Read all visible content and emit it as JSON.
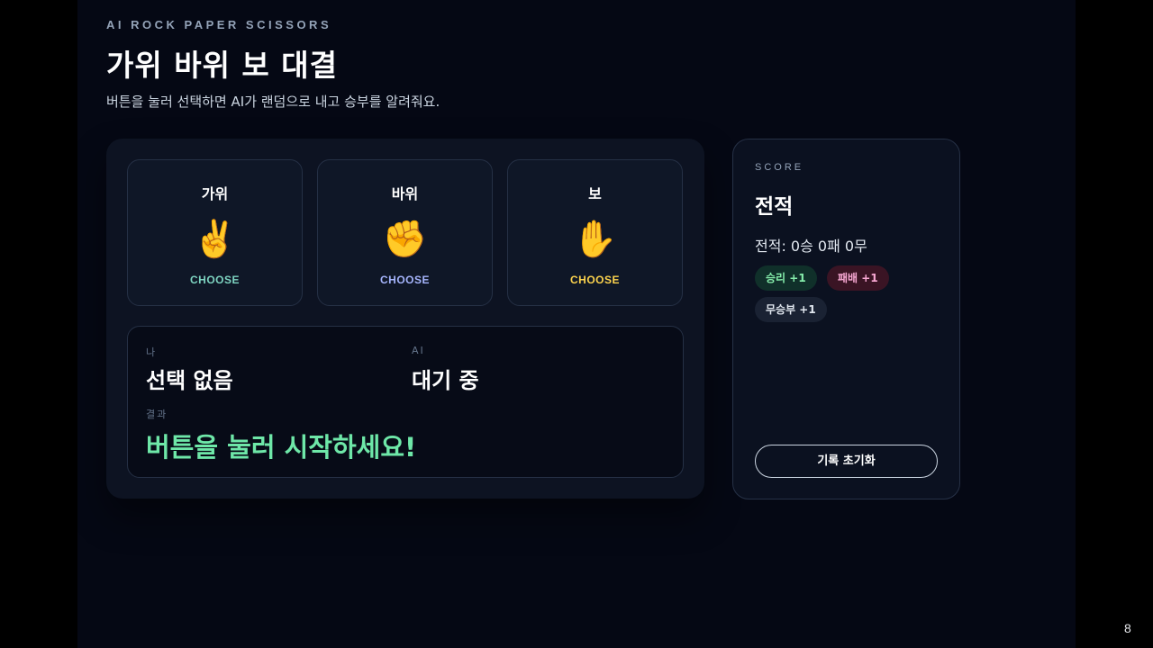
{
  "header": {
    "eyebrow": "AI ROCK PAPER SCISSORS",
    "title": "가위 바위 보 대결",
    "subtitle": "버튼을 눌러 선택하면 AI가 랜덤으로 내고 승부를 알려줘요."
  },
  "choices": [
    {
      "label": "가위",
      "emoji": "✌️",
      "cta": "CHOOSE",
      "icon": "victory-hand-icon",
      "cta_color": "#7dd3c0"
    },
    {
      "label": "바위",
      "emoji": "✊",
      "cta": "CHOOSE",
      "icon": "raised-fist-icon",
      "cta_color": "#a5b4fc"
    },
    {
      "label": "보",
      "emoji": "✋",
      "cta": "CHOOSE",
      "icon": "raised-hand-icon",
      "cta_color": "#fcd34d"
    }
  ],
  "result": {
    "me_label": "나",
    "me_value": "선택 없음",
    "ai_label": "AI",
    "ai_value": "대기 중",
    "result_label": "결과",
    "result_value": "버튼을 눌러 시작하세요!"
  },
  "score": {
    "eyebrow": "SCORE",
    "title": "전적",
    "record": "전적: 0승 0패 0무",
    "chips": [
      {
        "label": "승리 +1",
        "bg": "#10302a",
        "color": "#86efac"
      },
      {
        "label": "패배 +1",
        "bg": "#3a1424",
        "color": "#f9a8d4"
      },
      {
        "label": "무승부 +1",
        "bg": "#1a2233",
        "color": "#e2e8f0"
      }
    ],
    "reset_label": "기록 초기화"
  },
  "page_number": "8",
  "colors": {
    "background": "#050814",
    "panel": "#0d1322",
    "accent_green": "#6ee7a8"
  }
}
